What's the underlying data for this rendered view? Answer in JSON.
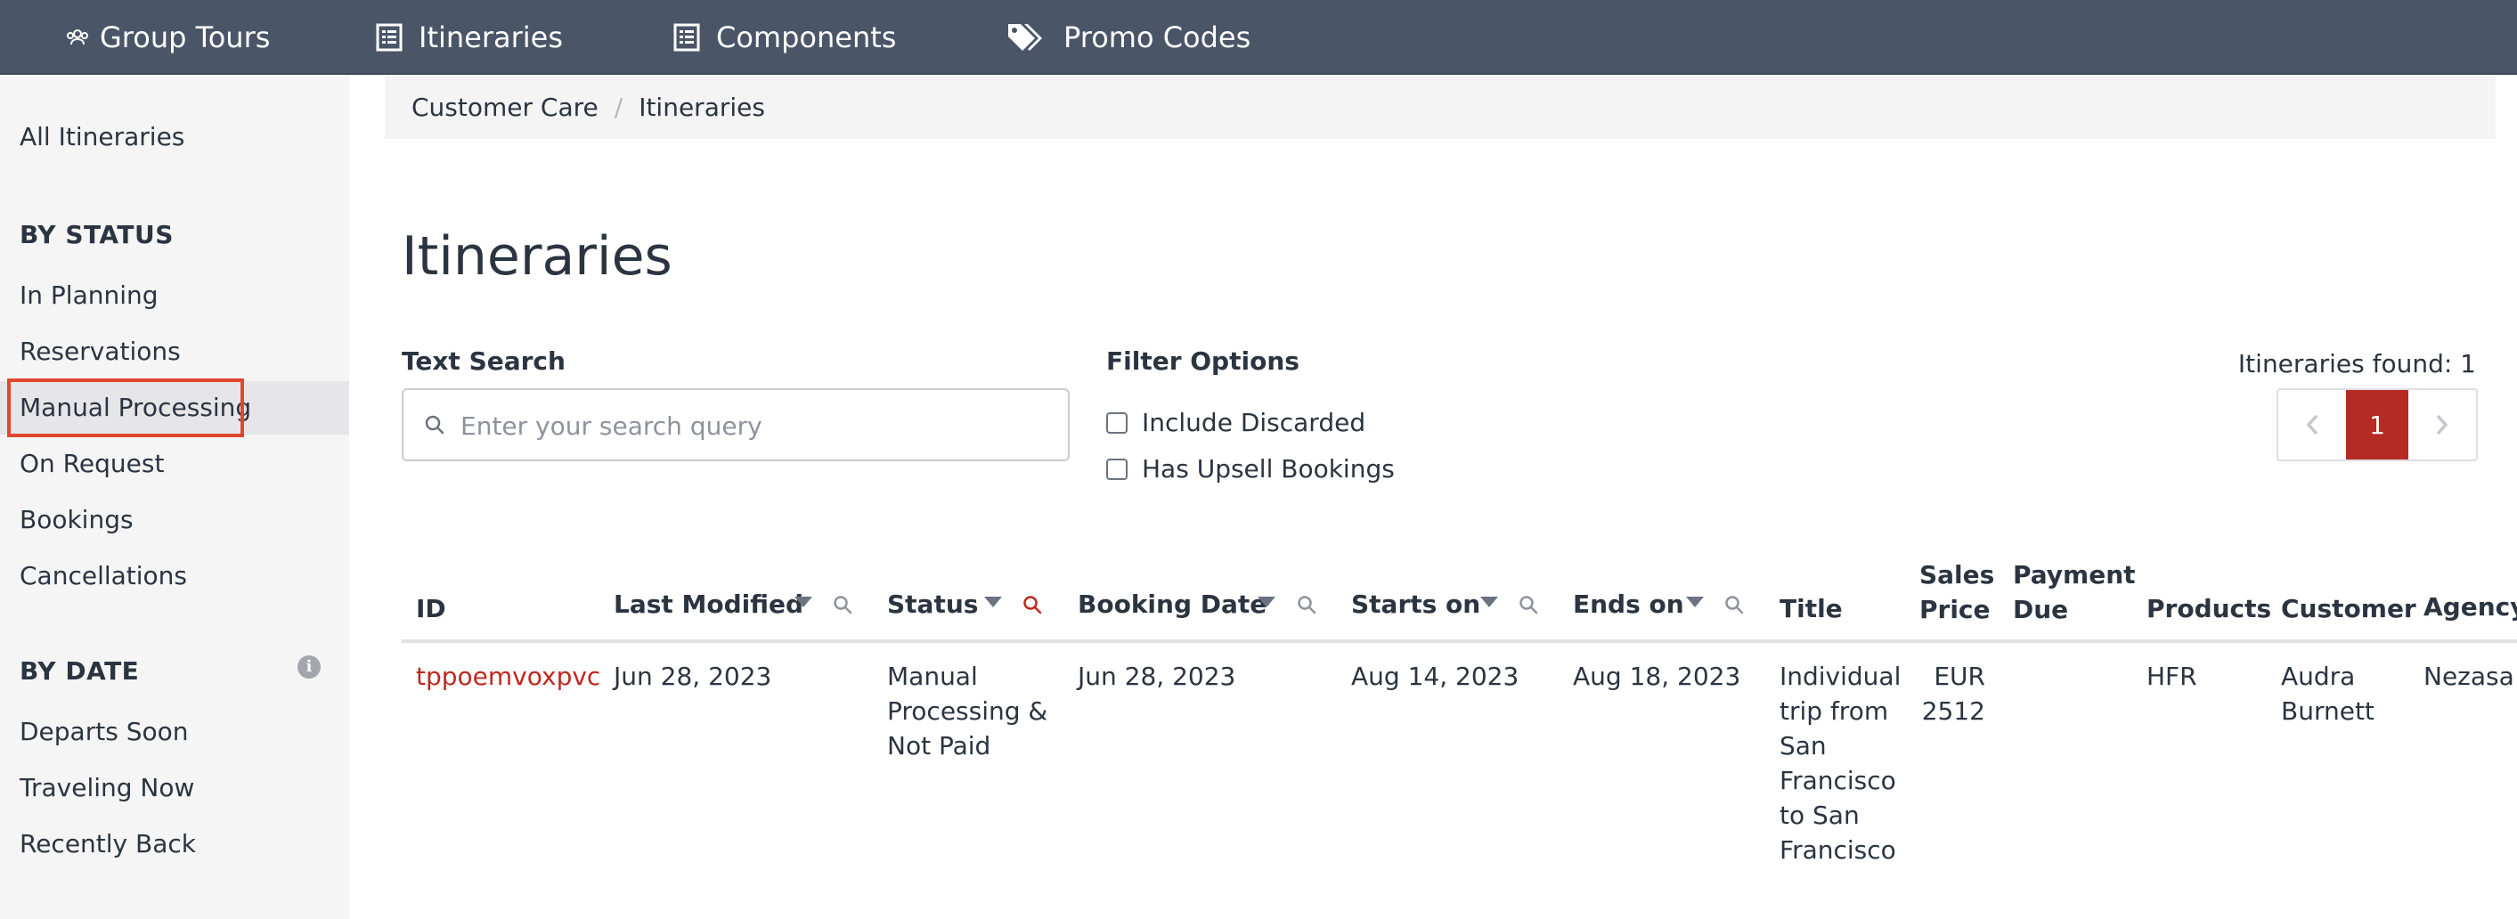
{
  "nav": {
    "items": [
      {
        "label": "Group Tours",
        "icon": "group-icon"
      },
      {
        "label": "Itineraries",
        "icon": "list-icon"
      },
      {
        "label": "Components",
        "icon": "list-icon"
      },
      {
        "label": "Promo Codes",
        "icon": "tags-icon"
      }
    ]
  },
  "sidebar": {
    "all": "All Itineraries",
    "by_status_heading": "BY STATUS",
    "status_items": [
      "In Planning",
      "Reservations",
      "Manual Processing",
      "On Request",
      "Bookings",
      "Cancellations"
    ],
    "active_item": "Manual Processing",
    "by_date_heading": "BY DATE",
    "date_items": [
      "Departs Soon",
      "Traveling Now",
      "Recently Back"
    ]
  },
  "breadcrumb": [
    "Customer Care",
    "Itineraries"
  ],
  "page": {
    "title": "Itineraries",
    "text_search_label": "Text Search",
    "search_placeholder": "Enter your search query",
    "filter_label": "Filter Options",
    "filters": [
      {
        "label": "Include Discarded",
        "checked": false
      },
      {
        "label": "Has Upsell Bookings",
        "checked": false
      }
    ],
    "found_text": "Itineraries found: 1",
    "current_page": "1"
  },
  "table": {
    "columns": {
      "id": "ID",
      "last_modified": "Last Modified",
      "status": "Status",
      "booking_date": "Booking Date",
      "starts_on": "Starts on",
      "ends_on": "Ends on",
      "title": "Title",
      "sales_price": [
        "Sales",
        "Price"
      ],
      "payment_due": [
        "Payment",
        "Due"
      ],
      "products": "Products",
      "customer": "Customer",
      "agency": "Agency"
    },
    "rows": [
      {
        "id": "tppoemvoxpvc",
        "last_modified": "Jun 28, 2023",
        "status": [
          "Manual",
          "Processing &",
          "Not Paid"
        ],
        "booking_date": "Jun 28, 2023",
        "starts_on": "Aug 14, 2023",
        "ends_on": "Aug 18, 2023",
        "title": [
          "Individual",
          "trip from",
          "San",
          "Francisco",
          "to San",
          "Francisco"
        ],
        "sales_price": [
          "EUR",
          "2512"
        ],
        "payment_due": "",
        "products": "HFR",
        "customer": [
          "Audra",
          "Burnett"
        ],
        "agency": "Nezasa"
      }
    ]
  },
  "colors": {
    "nav_bg": "#4a5568",
    "accent_red": "#b52a22",
    "active_outline": "#e0472e"
  }
}
